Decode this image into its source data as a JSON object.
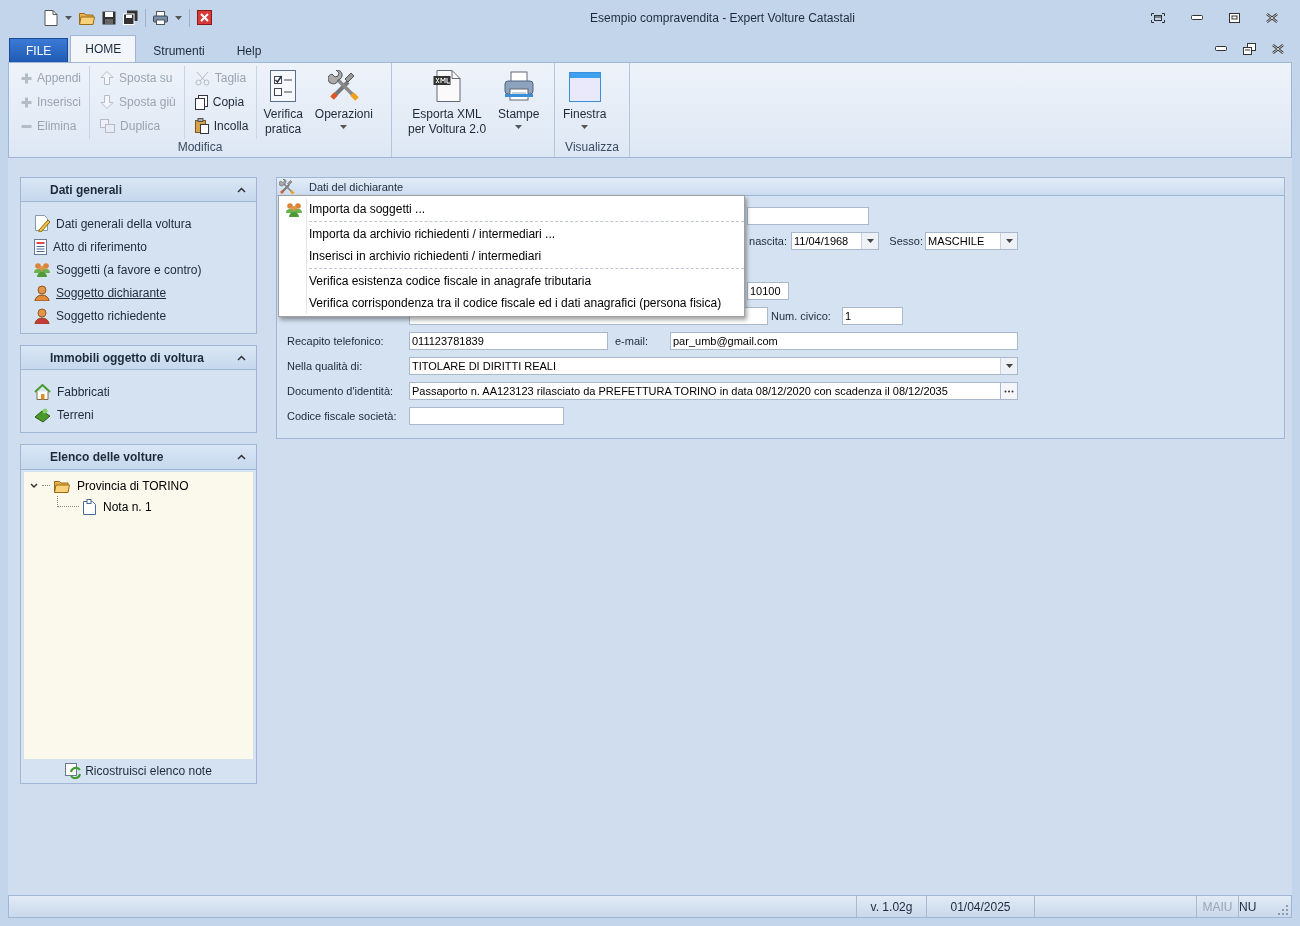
{
  "window": {
    "title": "Esempio compravendita - Expert Volture Catastali"
  },
  "ribbon_tabs": [
    {
      "label": "FILE",
      "kind": "file",
      "selected": false
    },
    {
      "label": "HOME",
      "kind": "tab",
      "selected": true
    },
    {
      "label": "Strumenti",
      "kind": "tab",
      "selected": false
    },
    {
      "label": "Help",
      "kind": "tab",
      "selected": false
    }
  ],
  "ribbon_groups": [
    {
      "label": "Modifica",
      "small_columns": [
        [
          {
            "label": "Appendi",
            "disabled": true
          },
          {
            "label": "Inserisci",
            "disabled": true
          },
          {
            "label": "Elimina",
            "disabled": true
          }
        ],
        [
          {
            "label": "Sposta su",
            "disabled": true
          },
          {
            "label": "Sposta giù",
            "disabled": true
          },
          {
            "label": "Duplica",
            "disabled": true
          }
        ],
        [
          {
            "label": "Taglia",
            "disabled": true
          },
          {
            "label": "Copia",
            "disabled": false
          },
          {
            "label": "Incolla",
            "disabled": false
          }
        ]
      ],
      "large_buttons": [
        {
          "label": "Verifica\npratica",
          "dropdown": false
        },
        {
          "label": "Operazioni",
          "dropdown": true
        }
      ]
    },
    {
      "large_buttons": [
        {
          "label": "Esporta XML\nper Voltura 2.0",
          "dropdown": false
        },
        {
          "label": "Stampe",
          "dropdown": true
        }
      ]
    },
    {
      "label": "Visualizza",
      "large_buttons": [
        {
          "label": "Finestra",
          "dropdown": true
        }
      ]
    }
  ],
  "sidebar": [
    {
      "title": "Dati generali",
      "items": [
        {
          "label": "Dati generali della voltura",
          "selected": false
        },
        {
          "label": "Atto di riferimento",
          "selected": false
        },
        {
          "label": "Soggetti (a favore e contro)",
          "selected": false
        },
        {
          "label": "Soggetto dichiarante",
          "selected": true
        },
        {
          "label": "Soggetto richiedente",
          "selected": false
        }
      ]
    },
    {
      "title": "Immobili oggetto di voltura",
      "items": [
        {
          "label": "Fabbricati",
          "selected": false
        },
        {
          "label": "Terreni",
          "selected": false
        }
      ]
    },
    {
      "title": "Elenco delle volture",
      "tree": [
        {
          "label": "Provincia di TORINO",
          "expanded": true,
          "children": [
            {
              "label": "Nota n. 1"
            }
          ]
        }
      ],
      "footer_button": "Ricostruisci elenco note"
    }
  ],
  "form": {
    "title": "Dati del dichiarante",
    "rows": [
      [
        {
          "kind": "text"
        }
      ],
      [
        {
          "kind": "label",
          "text": "nascita:"
        },
        {
          "kind": "combo",
          "value": "11/04/1968"
        },
        {
          "kind": "label",
          "text": "Sesso:"
        },
        {
          "kind": "combo",
          "value": "MASCHILE"
        }
      ],
      [
        {
          "kind": "text",
          "value": "10100"
        }
      ],
      [
        {
          "kind": "text"
        },
        {
          "kind": "label",
          "text": "Num. civico:"
        },
        {
          "kind": "text",
          "value": "1"
        }
      ],
      [
        {
          "kind": "label",
          "text": "Recapito telefonico:"
        },
        {
          "kind": "text",
          "value": "011123781839"
        },
        {
          "kind": "label",
          "text": "e-mail:"
        },
        {
          "kind": "text",
          "value": "par_umb@gmail.com"
        }
      ],
      [
        {
          "kind": "label",
          "text": "Nella qualità di:"
        },
        {
          "kind": "combo",
          "value": "TITOLARE DI DIRITTI REALI"
        }
      ],
      [
        {
          "kind": "label",
          "text": "Documento d'identità:"
        },
        {
          "kind": "browse",
          "value": "Passaporto n. AA123123 rilasciato da PREFETTURA TORINO in data 08/12/2020 con scadenza il 08/12/2035"
        }
      ],
      [
        {
          "kind": "label",
          "text": "Codice fiscale società:"
        },
        {
          "kind": "text"
        }
      ]
    ]
  },
  "context_menu": [
    {
      "kind": "item",
      "label": "Importa da soggetti ..."
    },
    {
      "kind": "separator"
    },
    {
      "kind": "item",
      "label": "Importa da archivio richiedenti / intermediari ..."
    },
    {
      "kind": "item",
      "label": "Inserisci in archivio richiedenti / intermediari"
    },
    {
      "kind": "separator"
    },
    {
      "kind": "item",
      "label": "Verifica esistenza codice fiscale in anagrafe tributaria"
    },
    {
      "kind": "item",
      "label": "Verifica corrispondenza tra il codice fiscale ed i dati anagrafici (persona fisica)"
    }
  ],
  "status_bar": {
    "version": "v. 1.02g",
    "date": "01/04/2025",
    "indicators": [
      {
        "label": "MAIU",
        "on": false
      },
      {
        "label": "NU",
        "on": true
      }
    ]
  }
}
